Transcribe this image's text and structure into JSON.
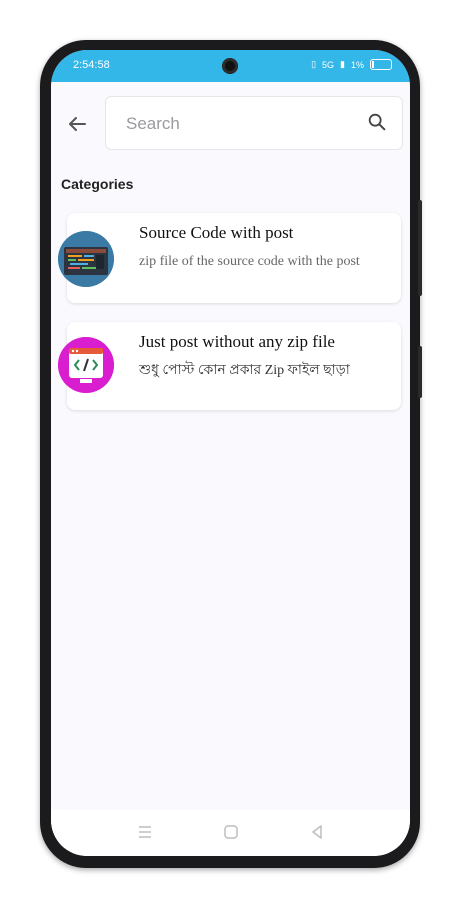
{
  "status_bar": {
    "time": "2:54:58",
    "signal_text": "5G",
    "battery_text": "1%"
  },
  "search": {
    "placeholder": "Search"
  },
  "section": {
    "title": "Categories"
  },
  "categories": [
    {
      "title": "Source Code with post",
      "subtitle": "zip file of the source code with the post",
      "icon": "code-editor-image"
    },
    {
      "title": "Just post without any zip file",
      "subtitle": "শুধু পোস্ট কোন প্রকার Zip  ফাইল ছাড়া",
      "icon": "html-code-icon"
    }
  ],
  "colors": {
    "status_bar": "#33b6e8",
    "accent_pink": "#d91ed0",
    "thumb_blue": "#3a7aa4"
  }
}
